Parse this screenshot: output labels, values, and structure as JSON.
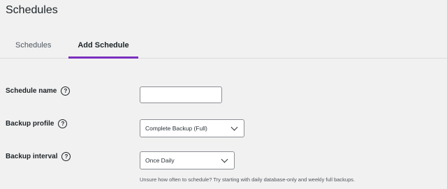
{
  "page": {
    "title": "Schedules"
  },
  "tabs": [
    {
      "label": "Schedules",
      "active": false
    },
    {
      "label": "Add Schedule",
      "active": true
    }
  ],
  "form": {
    "schedule_name": {
      "label": "Schedule name",
      "value": "",
      "help_icon": "question-circle-icon"
    },
    "backup_profile": {
      "label": "Backup profile",
      "selected": "Complete Backup (Full)",
      "help_icon": "question-circle-icon"
    },
    "backup_interval": {
      "label": "Backup interval",
      "selected": "Once Daily",
      "help_icon": "question-circle-icon"
    },
    "hint": "Unsure how often to schedule? Try starting with daily database-only and weekly full backups."
  },
  "colors": {
    "accent": "#7b2fbf",
    "background": "#f1f1f1"
  }
}
